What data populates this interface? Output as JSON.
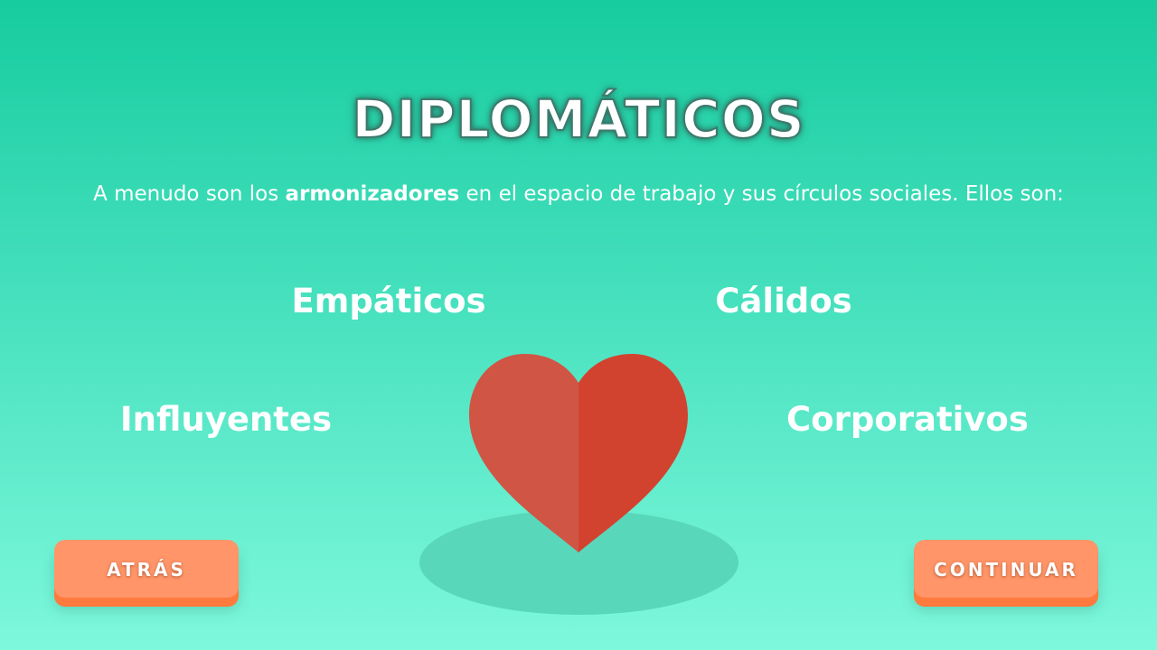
{
  "title": "DIPLOMÁTICOS",
  "subtitle": {
    "before": "A menudo son los ",
    "bold": "armonizadores",
    "after": " en el espacio de trabajo y sus círculos sociales. Ellos son:"
  },
  "traits": [
    "Empáticos",
    "Cálidos",
    "Influyentes",
    "Corporativos"
  ],
  "illustration": "heart-icon",
  "buttons": {
    "back": "ATRÁS",
    "next": "CONTINUAR"
  },
  "colors": {
    "background_top": "#17cc9f",
    "background_bottom": "#7ef8dc",
    "heart_left": "#d05545",
    "heart_right": "#d2432f",
    "button": "#ff9568"
  }
}
